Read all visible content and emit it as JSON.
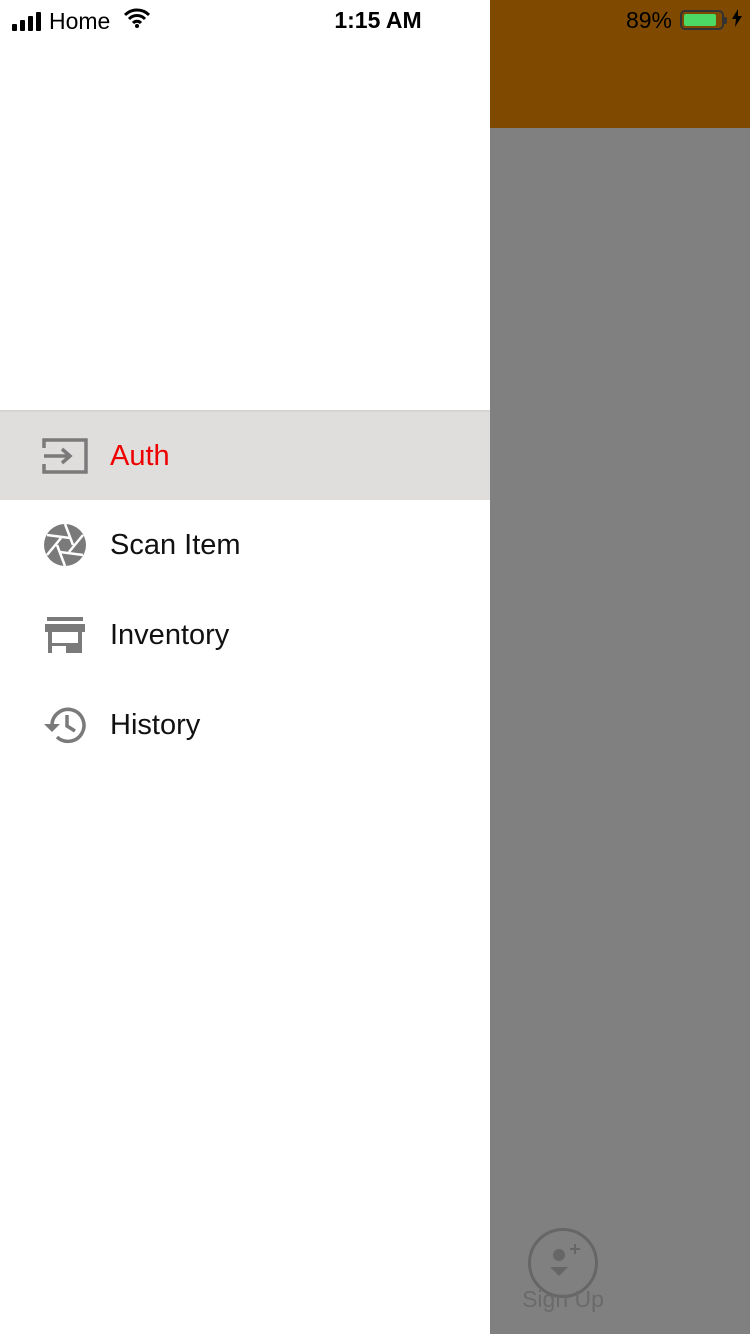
{
  "status_bar": {
    "carrier": "Home",
    "time": "1:15 AM",
    "battery_percent": "89%",
    "battery_level": 0.89,
    "battery_color": "#4cd964"
  },
  "drawer": {
    "active_color": "#ee0000",
    "items": [
      {
        "label": "Auth",
        "icon": "login-icon",
        "active": true
      },
      {
        "label": "Scan Item",
        "icon": "camera-shutter-icon",
        "active": false
      },
      {
        "label": "Inventory",
        "icon": "store-icon",
        "active": false
      },
      {
        "label": "History",
        "icon": "history-icon",
        "active": false
      }
    ]
  },
  "background_app": {
    "header_color": "#7f4a00",
    "signup_label": "Sign Up"
  }
}
